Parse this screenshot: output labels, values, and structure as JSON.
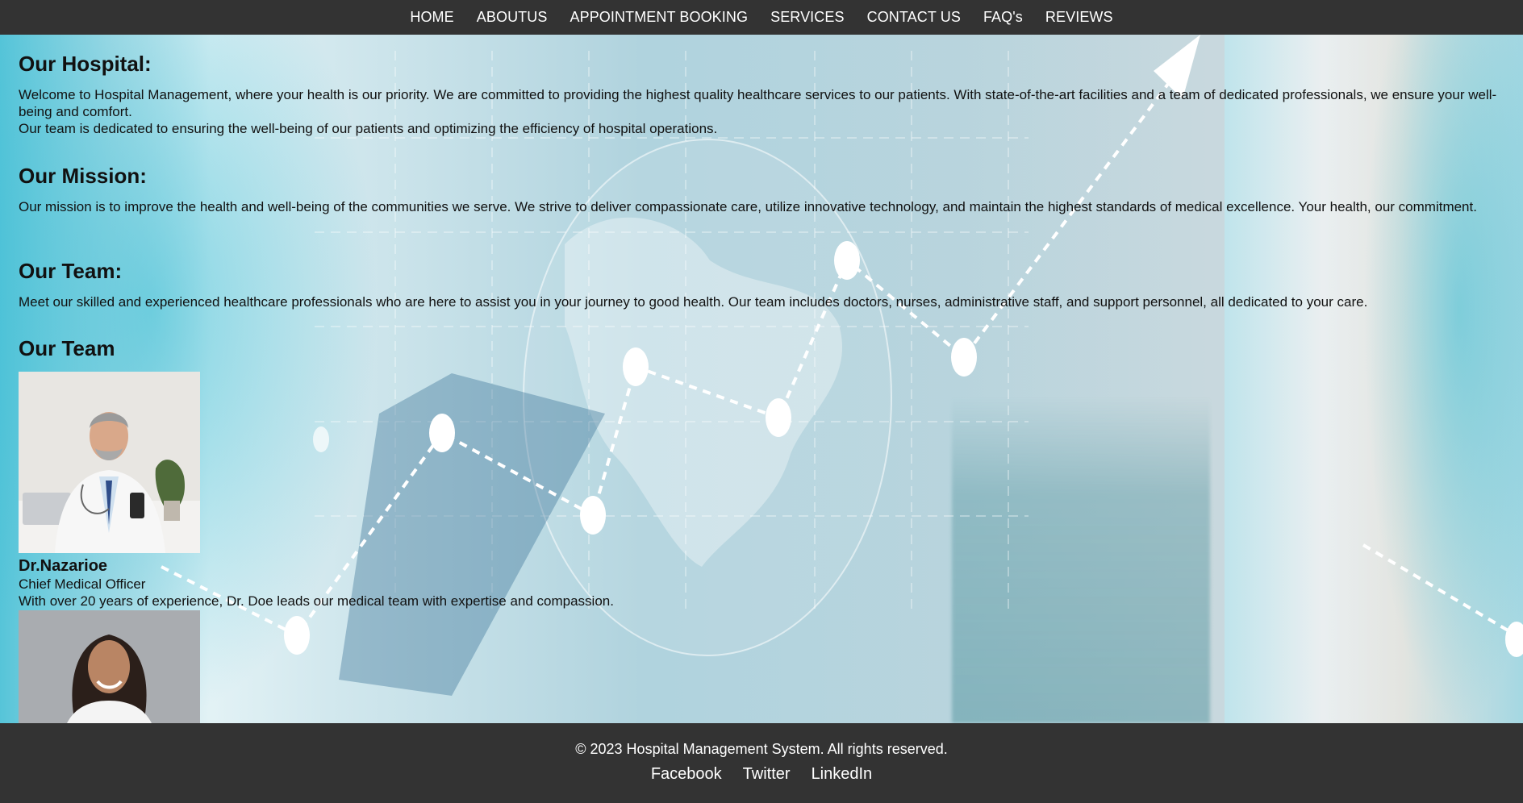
{
  "nav": {
    "items": [
      {
        "label": "HOME"
      },
      {
        "label": "ABOUTUS"
      },
      {
        "label": "APPOINTMENT BOOKING"
      },
      {
        "label": "SERVICES"
      },
      {
        "label": "CONTACT US"
      },
      {
        "label": "FAQ's"
      },
      {
        "label": "REVIEWS"
      }
    ]
  },
  "about": {
    "hospital_title": "Our Hospital:",
    "hospital_text": "Welcome to Hospital Management, where your health is our priority. We are committed to providing the highest quality healthcare services to our patients. With state-of-the-art facilities and a team of dedicated professionals, we ensure your well-being and comfort.",
    "hospital_text2": "Our team is dedicated to ensuring the well-being of our patients and optimizing the efficiency of hospital operations.",
    "mission_title": "Our Mission:",
    "mission_text": "Our mission is to improve the health and well-being of the communities we serve. We strive to deliver compassionate care, utilize innovative technology, and maintain the highest standards of medical excellence. Your health, our commitment.",
    "team_title": "Our Team:",
    "team_text": "Meet our skilled and experienced healthcare professionals who are here to assist you in your journey to good health. Our team includes doctors, nurses, administrative staff, and support personnel, all dedicated to your care."
  },
  "team": {
    "heading": "Our Team",
    "members": [
      {
        "name": "Dr.Nazarioe",
        "role": "Chief Medical Officer",
        "bio": "With over 20 years of experience, Dr. Doe leads our medical team with expertise and compassion."
      }
    ]
  },
  "footer": {
    "copyright": "© 2023 Hospital Management System. All rights reserved.",
    "links": [
      {
        "label": "Facebook"
      },
      {
        "label": "Twitter"
      },
      {
        "label": "LinkedIn"
      }
    ]
  },
  "colors": {
    "bar": "#333333",
    "bar_text": "#ffffff",
    "accent": "#2db9d2"
  }
}
